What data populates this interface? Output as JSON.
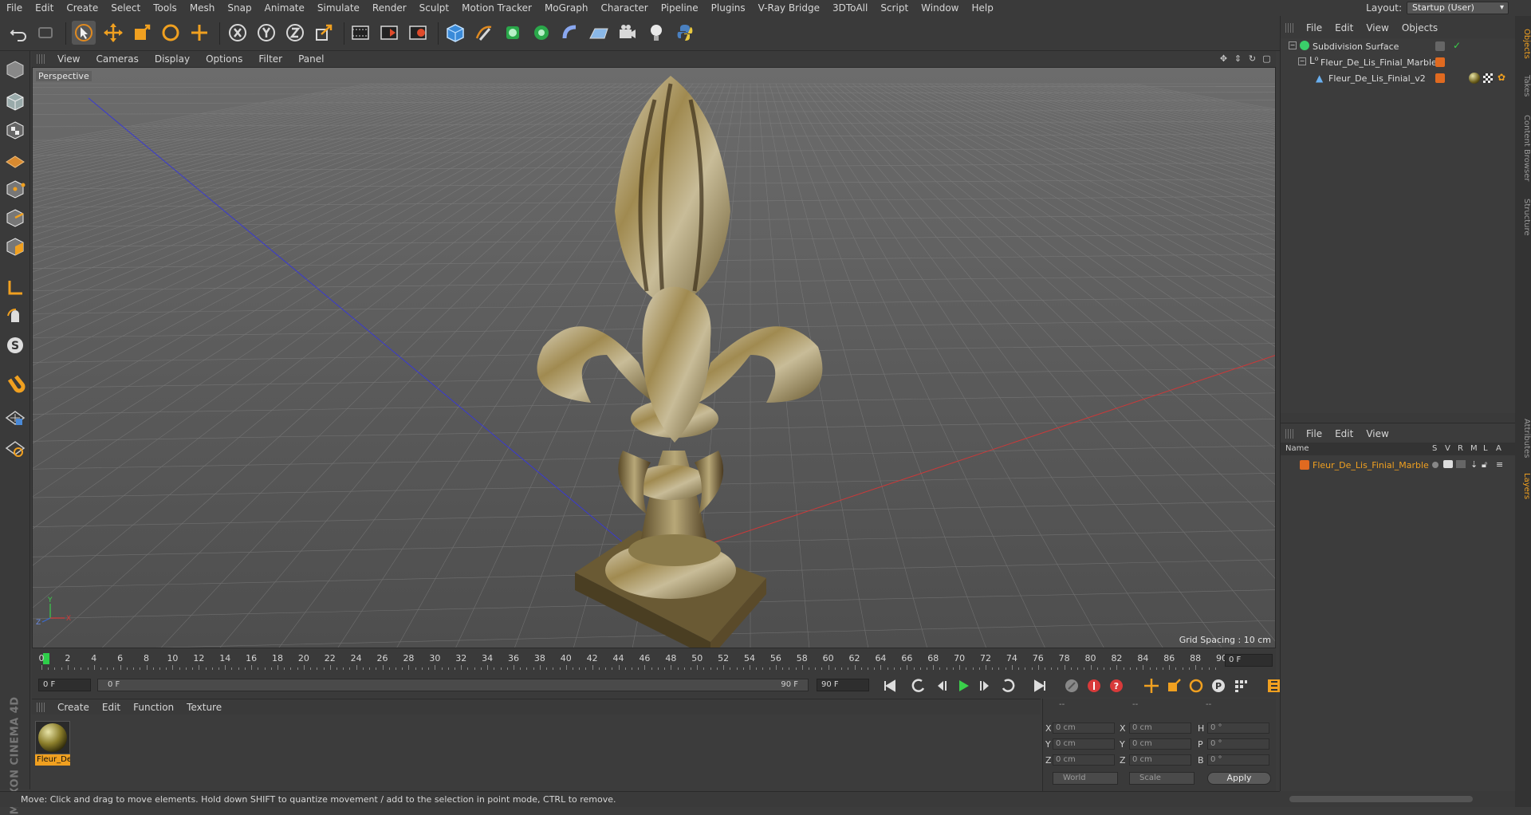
{
  "menu": [
    "File",
    "Edit",
    "Create",
    "Select",
    "Tools",
    "Mesh",
    "Snap",
    "Animate",
    "Simulate",
    "Render",
    "Sculpt",
    "Motion Tracker",
    "MoGraph",
    "Character",
    "Pipeline",
    "Plugins",
    "V-Ray Bridge",
    "3DToAll",
    "Script",
    "Window",
    "Help"
  ],
  "layout": {
    "label": "Layout:",
    "value": "Startup (User)"
  },
  "viewport": {
    "menu": [
      "View",
      "Cameras",
      "Display",
      "Options",
      "Filter",
      "Panel"
    ],
    "label": "Perspective",
    "grid_spacing": "Grid Spacing : 10 cm"
  },
  "timeline": {
    "ticks": [
      "0",
      "2",
      "4",
      "6",
      "8",
      "10",
      "12",
      "14",
      "16",
      "18",
      "20",
      "22",
      "24",
      "26",
      "28",
      "30",
      "32",
      "34",
      "36",
      "38",
      "40",
      "42",
      "44",
      "46",
      "48",
      "50",
      "52",
      "54",
      "56",
      "58",
      "60",
      "62",
      "64",
      "66",
      "68",
      "70",
      "72",
      "74",
      "76",
      "78",
      "80",
      "82",
      "84",
      "86",
      "88",
      "90"
    ],
    "current_frame": "0 F"
  },
  "transport": {
    "start_field": "0 F",
    "scrub_left": "0 F",
    "scrub_right": "90 F",
    "end_field": "90 F"
  },
  "material_menu": [
    "Create",
    "Edit",
    "Function",
    "Texture"
  ],
  "material": {
    "name": "Fleur_De_Lis_Finial_Marble",
    "short": "Fleur_De"
  },
  "coordinates": {
    "headers": [
      "--",
      "--",
      "--"
    ],
    "rows": [
      {
        "a": "X",
        "v1": "0 cm",
        "b": "X",
        "v2": "0 cm",
        "c": "H",
        "v3": "0 °"
      },
      {
        "a": "Y",
        "v1": "0 cm",
        "b": "Y",
        "v2": "0 cm",
        "c": "P",
        "v3": "0 °"
      },
      {
        "a": "Z",
        "v1": "0 cm",
        "b": "Z",
        "v2": "0 cm",
        "c": "B",
        "v3": "0 °"
      }
    ],
    "mode1": "World",
    "mode2": "Scale",
    "apply": "Apply"
  },
  "objects_menu": [
    "File",
    "Edit",
    "View",
    "Objects"
  ],
  "objects": [
    {
      "name": "Subdivision Surface"
    },
    {
      "name": "Fleur_De_Lis_Finial_Marble"
    },
    {
      "name": "Fleur_De_Lis_Finial_v2"
    }
  ],
  "layers_menu": [
    "File",
    "Edit",
    "View"
  ],
  "layers_header": {
    "name": "Name",
    "cols": [
      "S",
      "V",
      "R",
      "M",
      "L",
      "A"
    ]
  },
  "layers": [
    {
      "name": "Fleur_De_Lis_Finial_Marble"
    }
  ],
  "side_tabs": [
    "Objects",
    "Takes",
    "Content Browser",
    "Structure",
    "Attributes",
    "Layers"
  ],
  "status": "Move: Click and drag to move elements. Hold down SHIFT to quantize movement / add to the selection in point mode, CTRL to remove.",
  "colors": {
    "accent": "#f0a020",
    "x_axis": "#c83a3a",
    "z_axis": "#3a3acf",
    "frame_marker": "#2ecf4a"
  }
}
